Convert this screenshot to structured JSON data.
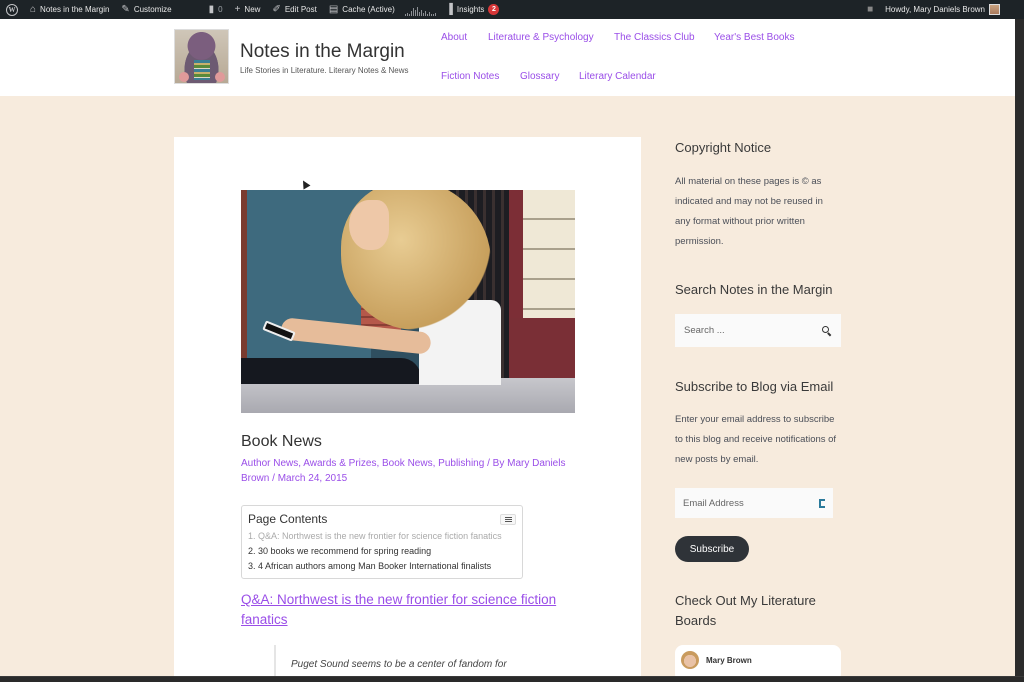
{
  "admin_bar": {
    "wp_logo": "W",
    "site_name": "Notes in the Margin",
    "customize": "Customize",
    "comments_count": "0",
    "new_label": "New",
    "edit_post": "Edit Post",
    "cache": "Cache (Active)",
    "insights": "Insights",
    "insights_badge": "2",
    "howdy": "Howdy, Mary Daniels Brown"
  },
  "header": {
    "site_title": "Notes in the Margin",
    "tagline": "Life Stories in Literature. Literary Notes & News",
    "nav": [
      {
        "label": "About"
      },
      {
        "label": "Literature & Psychology"
      },
      {
        "label": "The Classics Club"
      },
      {
        "label": "Year's Best Books"
      },
      {
        "label": "Fiction Notes"
      },
      {
        "label": "Glossary"
      },
      {
        "label": "Literary Calendar"
      }
    ]
  },
  "post": {
    "title": "Book News",
    "categories": [
      "Author News",
      "Awards & Prizes",
      "Book News",
      "Publishing"
    ],
    "separator": ", ",
    "by_prefix": " / By ",
    "author": "Mary Daniels Brown",
    "date_prefix": " / ",
    "date": "March 24, 2015",
    "toc": {
      "title": "Page Contents",
      "items": [
        {
          "label": "1. Q&A: Northwest is the new frontier for science fiction fanatics"
        },
        {
          "label": "2. 30 books we recommend for spring reading"
        },
        {
          "label": "3. 4 African authors among Man Booker International finalists"
        }
      ]
    },
    "section_heading": "Q&A: Northwest is the new frontier for science fiction fanatics",
    "quote_text": "Puget Sound seems to be a center of fandom for"
  },
  "sidebar": {
    "copyright": {
      "title": "Copyright Notice",
      "text": "All material on these pages is © as indicated and may not be reused in any format without prior written permission."
    },
    "search": {
      "title": "Search Notes in the Margin",
      "placeholder": "Search ..."
    },
    "subscribe": {
      "title": "Subscribe to Blog via Email",
      "text": "Enter your email address to subscribe to this blog and receive notifications of new posts by email.",
      "email_placeholder": "Email Address",
      "button": "Subscribe"
    },
    "boards": {
      "title": "Check Out My Literature Boards",
      "profile_name": "Mary Brown"
    }
  },
  "colors": {
    "accent": "#9a4ee8",
    "page_bg": "#f7ebdd",
    "admin_bar": "#1d2327",
    "button_dark": "#2f3338"
  }
}
